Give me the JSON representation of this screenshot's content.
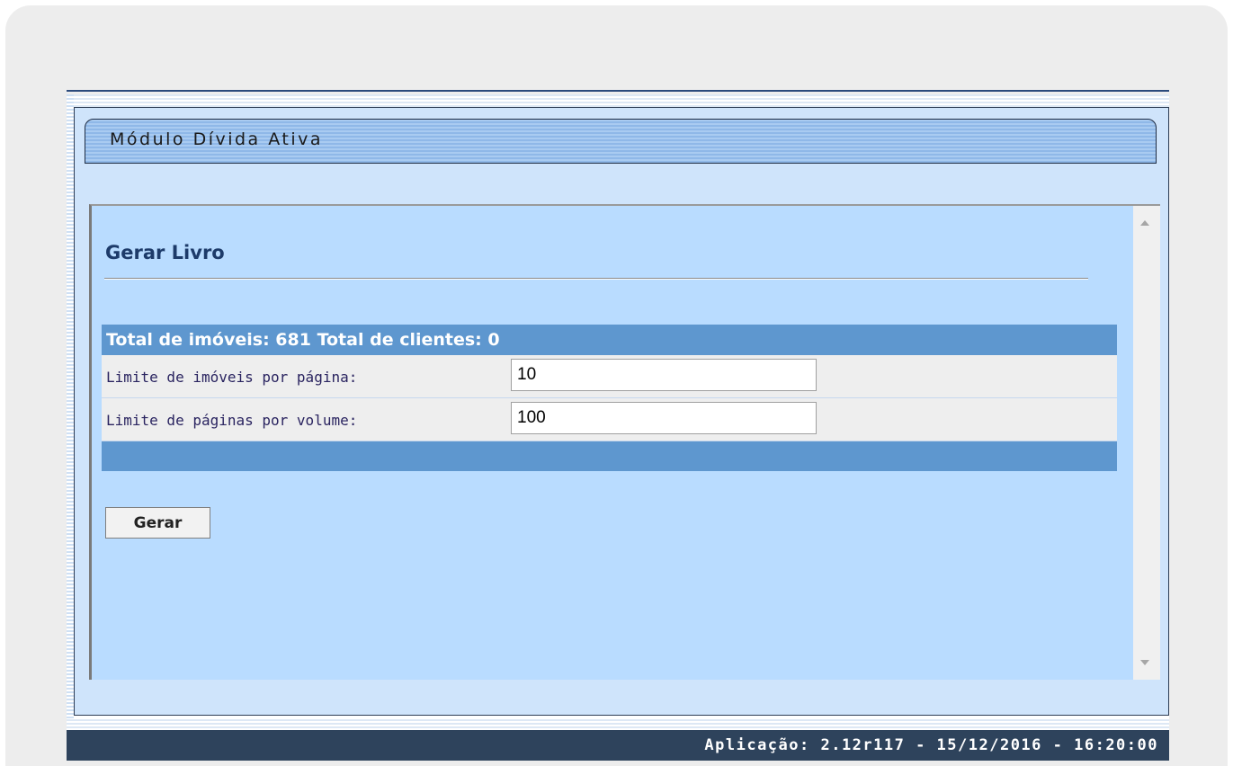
{
  "module": {
    "title": "Módulo Dívida Ativa"
  },
  "page": {
    "title": "Gerar Livro"
  },
  "form": {
    "header": "Total de imóveis: 681 Total de clientes: 0",
    "fields": [
      {
        "label": "Limite de imóveis por página:",
        "value": "10"
      },
      {
        "label": "Limite de páginas por volume:",
        "value": "100"
      }
    ],
    "submit_label": "Gerar"
  },
  "status": {
    "text": "Aplicação: 2.12r117 - 15/12/2016 - 16:20:00"
  },
  "colors": {
    "header_bar": "#5e97cf",
    "content_bg": "#b9dcff",
    "status_bar": "#2e435c",
    "title": "#1d3b6a"
  },
  "icons": {
    "scroll_up": "scroll-up-arrow-icon",
    "scroll_down": "scroll-down-arrow-icon"
  }
}
